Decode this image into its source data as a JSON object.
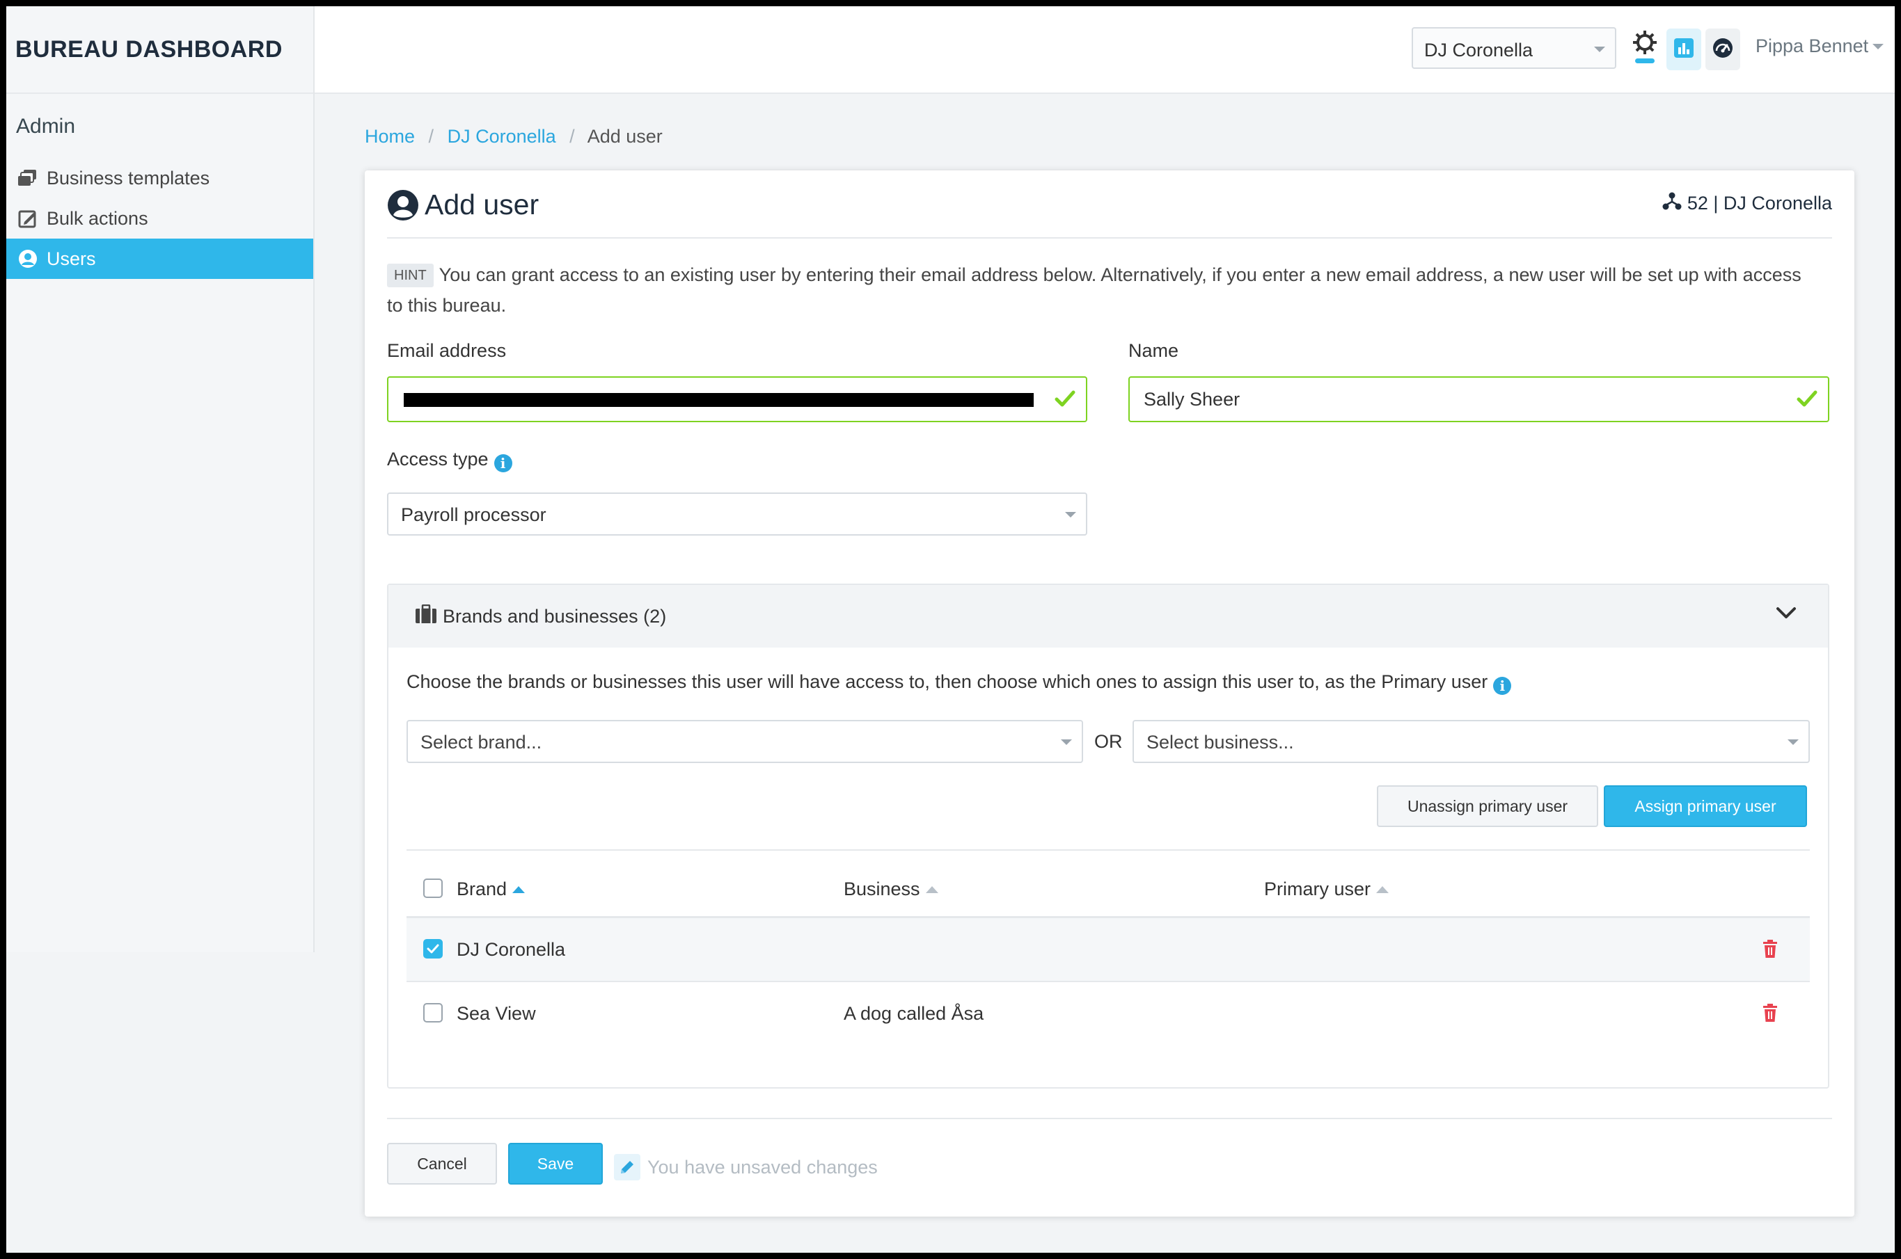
{
  "app_title": "BUREAU DASHBOARD",
  "sidebar": {
    "heading": "Admin",
    "items": [
      {
        "label": "Business templates",
        "icon": "stack-icon"
      },
      {
        "label": "Bulk actions",
        "icon": "edit-box-icon"
      },
      {
        "label": "Users",
        "icon": "user-circle-icon",
        "active": true
      }
    ]
  },
  "topbar": {
    "client_select": "DJ Coronella",
    "user_name": "Pippa Bennet"
  },
  "breadcrumb": {
    "home": "Home",
    "client": "DJ Coronella",
    "current": "Add user"
  },
  "card": {
    "title": "Add user",
    "meta": "52 | DJ Coronella",
    "hint_tag": "HINT",
    "hint_text": "You can grant access to an existing user by entering their email address below. Alternatively, if you enter a new email address, a new user will be set up with access to this bureau."
  },
  "form": {
    "email_label": "Email address",
    "email_value": "",
    "name_label": "Name",
    "name_value": "Sally Sheer",
    "access_label": "Access type",
    "access_value": "Payroll processor"
  },
  "brands_panel": {
    "title": "Brands and businesses (2)",
    "description": "Choose the brands or businesses this user will have access to, then choose which ones to assign this user to, as the Primary user",
    "brand_placeholder": "Select brand...",
    "or_label": "OR",
    "business_placeholder": "Select business...",
    "unassign_button": "Unassign primary user",
    "assign_button": "Assign primary user",
    "columns": [
      "Brand",
      "Business",
      "Primary user"
    ],
    "rows": [
      {
        "brand": "DJ Coronella",
        "business": "",
        "primary_user": "",
        "checked": true
      },
      {
        "brand": "Sea View",
        "business": "A dog called Åsa",
        "primary_user": "",
        "checked": false
      }
    ]
  },
  "footer": {
    "cancel_label": "Cancel",
    "save_label": "Save",
    "unsaved_text": "You have unsaved changes"
  },
  "colors": {
    "accent": "#2fb7ea",
    "valid": "#7ed321",
    "danger": "#e8424f",
    "text_dark": "#1f2d3d"
  }
}
